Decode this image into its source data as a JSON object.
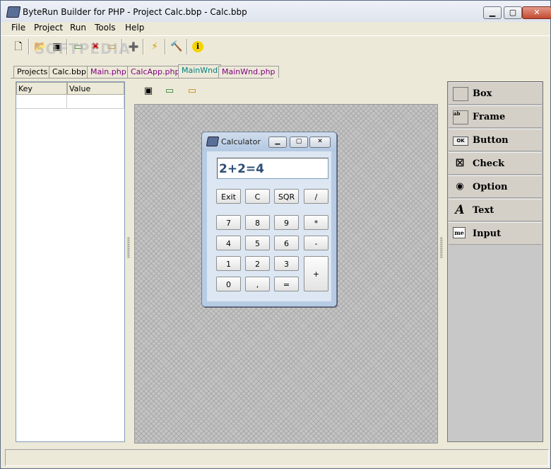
{
  "window": {
    "title": "ByteRun Builder for PHP - Project Calc.bbp - Calc.bbp",
    "min": "▁",
    "max": "▢",
    "close": "✕"
  },
  "menu": [
    "File",
    "Project",
    "Run",
    "Tools",
    "Help"
  ],
  "toolbar": {
    "new": "🗋",
    "open": "📂",
    "windows": "▣",
    "run-form": "▭",
    "delete": "✖",
    "form": "▭",
    "add": "➕",
    "run": "⚡",
    "build": "🔨",
    "about": "ℹ"
  },
  "watermark": "SOFTPEDIA",
  "tabs": [
    "Projects",
    "Calc.bbp",
    "Main.php",
    "CalcApp.php",
    "MainWnd",
    "MainWnd.php"
  ],
  "property_grid": {
    "key_header": "Key",
    "value_header": "Value"
  },
  "form_toolbar": {
    "windows": "▣",
    "form": "▭",
    "form-edit": "▭"
  },
  "calculator": {
    "title": "Calculator",
    "display": "2+2=4",
    "keys": [
      "Exit",
      "C",
      "SQR",
      "/",
      "7",
      "8",
      "9",
      "*",
      "4",
      "5",
      "6",
      "-",
      "1",
      "2",
      "3",
      "+",
      "0",
      ",",
      "="
    ]
  },
  "palette": [
    {
      "label": "Box",
      "icon": "box-icon",
      "glyph": ""
    },
    {
      "label": "Frame",
      "icon": "frame-icon",
      "glyph": "ab"
    },
    {
      "label": "Button",
      "icon": "button-icon",
      "glyph": "OK"
    },
    {
      "label": "Check",
      "icon": "checkbox-icon",
      "glyph": "☒"
    },
    {
      "label": "Option",
      "icon": "radio-icon",
      "glyph": "◉"
    },
    {
      "label": "Text",
      "icon": "text-icon",
      "glyph": "A"
    },
    {
      "label": "Input",
      "icon": "input-icon",
      "glyph": "me"
    }
  ]
}
